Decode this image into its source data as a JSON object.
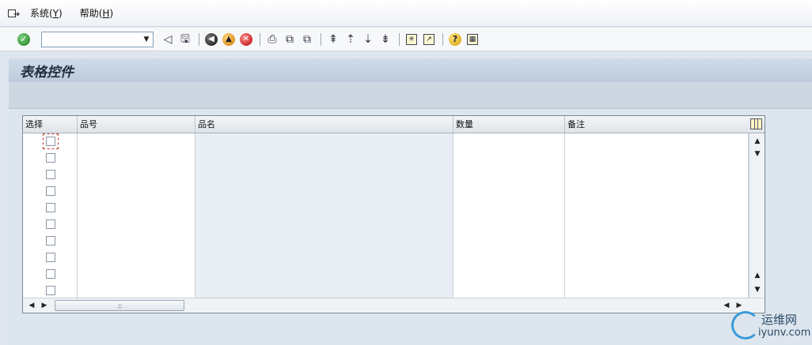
{
  "menubar": {
    "items": [
      {
        "label": "系统(",
        "key": "Y",
        "close": ")"
      },
      {
        "label": "帮助(",
        "key": "H",
        "close": ")"
      }
    ]
  },
  "toolbar": {
    "command_value": "",
    "command_placeholder": ""
  },
  "screen": {
    "title": "表格控件"
  },
  "table": {
    "columns": [
      "选择",
      "品号",
      "品名",
      "数量",
      "备注"
    ],
    "rows": [
      {
        "selected": false,
        "item_no": "",
        "item_name": "",
        "qty": "",
        "remark": ""
      },
      {
        "selected": false,
        "item_no": "",
        "item_name": "",
        "qty": "",
        "remark": ""
      },
      {
        "selected": false,
        "item_no": "",
        "item_name": "",
        "qty": "",
        "remark": ""
      },
      {
        "selected": false,
        "item_no": "",
        "item_name": "",
        "qty": "",
        "remark": ""
      },
      {
        "selected": false,
        "item_no": "",
        "item_name": "",
        "qty": "",
        "remark": ""
      },
      {
        "selected": false,
        "item_no": "",
        "item_name": "",
        "qty": "",
        "remark": ""
      },
      {
        "selected": false,
        "item_no": "",
        "item_name": "",
        "qty": "",
        "remark": ""
      },
      {
        "selected": false,
        "item_no": "",
        "item_name": "",
        "qty": "",
        "remark": ""
      },
      {
        "selected": false,
        "item_no": "",
        "item_name": "",
        "qty": "",
        "remark": ""
      },
      {
        "selected": false,
        "item_no": "",
        "item_name": "",
        "qty": "",
        "remark": ""
      }
    ]
  },
  "watermark": {
    "cn": "运维网",
    "en": "iyunv.com"
  },
  "colors": {
    "title_band": "#c6d4e2",
    "content_bg": "#dde5ee",
    "focus": "#c0392b",
    "shaded_column": "#e8eef4"
  }
}
